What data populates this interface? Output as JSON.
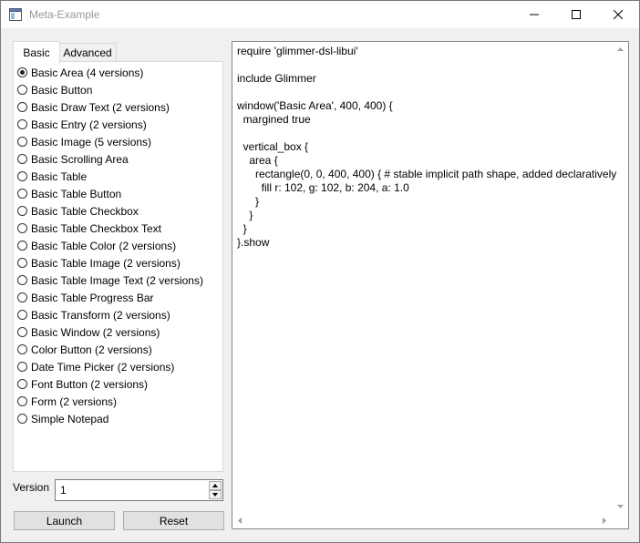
{
  "window": {
    "title": "Meta-Example"
  },
  "tabs": [
    {
      "label": "Basic",
      "selected": true
    },
    {
      "label": "Advanced",
      "selected": false
    }
  ],
  "examples": [
    {
      "label": "Basic Area (4 versions)",
      "checked": true
    },
    {
      "label": "Basic Button",
      "checked": false
    },
    {
      "label": "Basic Draw Text (2 versions)",
      "checked": false
    },
    {
      "label": "Basic Entry (2 versions)",
      "checked": false
    },
    {
      "label": "Basic Image (5 versions)",
      "checked": false
    },
    {
      "label": "Basic Scrolling Area",
      "checked": false
    },
    {
      "label": "Basic Table",
      "checked": false
    },
    {
      "label": "Basic Table Button",
      "checked": false
    },
    {
      "label": "Basic Table Checkbox",
      "checked": false
    },
    {
      "label": "Basic Table Checkbox Text",
      "checked": false
    },
    {
      "label": "Basic Table Color (2 versions)",
      "checked": false
    },
    {
      "label": "Basic Table Image (2 versions)",
      "checked": false
    },
    {
      "label": "Basic Table Image Text (2 versions)",
      "checked": false
    },
    {
      "label": "Basic Table Progress Bar",
      "checked": false
    },
    {
      "label": "Basic Transform (2 versions)",
      "checked": false
    },
    {
      "label": "Basic Window (2 versions)",
      "checked": false
    },
    {
      "label": "Color Button (2 versions)",
      "checked": false
    },
    {
      "label": "Date Time Picker (2 versions)",
      "checked": false
    },
    {
      "label": "Font Button (2 versions)",
      "checked": false
    },
    {
      "label": "Form (2 versions)",
      "checked": false
    },
    {
      "label": "Simple Notepad",
      "checked": false
    }
  ],
  "version": {
    "label": "Version",
    "value": "1"
  },
  "buttons": {
    "launch": "Launch",
    "reset": "Reset"
  },
  "code": [
    "require 'glimmer-dsl-libui'",
    "",
    "include Glimmer",
    "",
    "window('Basic Area', 400, 400) {",
    "  margined true",
    "",
    "  vertical_box {",
    "    area {",
    "      rectangle(0, 0, 400, 400) { # stable implicit path shape, added declaratively",
    "        fill r: 102, g: 102, b: 204, a: 1.0",
    "      }",
    "    }",
    "  }",
    "}.show"
  ],
  "icons": {
    "app": "window-app-icon",
    "minimize": "minimize-icon",
    "maximize": "maximize-icon",
    "close": "close-icon"
  }
}
